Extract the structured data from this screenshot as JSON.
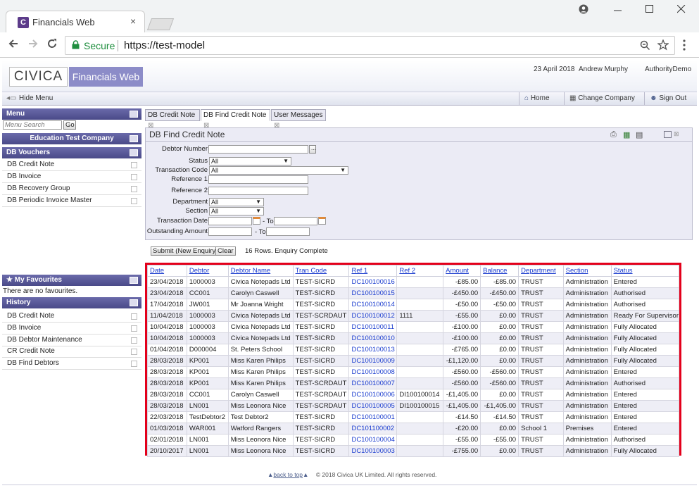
{
  "browser": {
    "tab_title": "Financials Web",
    "tab_icon": "C",
    "tab_close": "×",
    "secure_label": "Secure",
    "url": "https://test-model"
  },
  "header": {
    "logo_left": "CIVICA",
    "logo_right": "Financials Web",
    "date": "23 April 2018",
    "user": "Andrew Murphy",
    "authority": "AuthorityDemo"
  },
  "toolbar": {
    "hide_menu": "Hide Menu",
    "home": "Home",
    "change_company": "Change Company",
    "sign_out": "Sign Out"
  },
  "sidebar": {
    "menu_title": "Menu",
    "search_placeholder": "Menu Search",
    "go_label": "Go",
    "company": "Education Test Company",
    "vouchers_title": "DB Vouchers",
    "vouchers": [
      "DB Credit Note",
      "DB Invoice",
      "DB Recovery Group",
      "DB Periodic Invoice Master"
    ],
    "favourites_title": "My Favourites",
    "favourites_empty": "There are no favourites.",
    "history_title": "History",
    "history": [
      "DB Credit Note",
      "DB Invoice",
      "DB Debtor Maintenance",
      "CR Credit Note",
      "DB Find Debtors"
    ]
  },
  "content_tabs": [
    "DB Credit Note",
    "DB Find Credit Note",
    "User Messages"
  ],
  "panel": {
    "title": "DB Find Credit Note",
    "labels": {
      "debtor_number": "Debtor Number",
      "status": "Status",
      "transaction_code": "Transaction Code",
      "reference1": "Reference 1",
      "reference2": "Reference 2",
      "department": "Department",
      "section": "Section",
      "transaction_date": "Transaction Date",
      "outstanding_amount": "Outstanding Amount",
      "to": "- To"
    },
    "values": {
      "status": "All",
      "transaction_code": "All",
      "department": "All",
      "section": "All"
    },
    "submit": "Submit (New Enquiry)",
    "clear": "Clear",
    "result_text": "16 Rows. Enquiry Complete"
  },
  "table": {
    "headers": [
      "Date",
      "Debtor",
      "Debtor Name",
      "Tran Code",
      "Ref 1",
      "Ref 2",
      "Amount",
      "Balance",
      "Department",
      "Section",
      "Status"
    ],
    "rows": [
      [
        "23/04/2018",
        "1000003",
        "Civica Notepads Ltd",
        "TEST-SICRD",
        "DC100100016",
        "",
        "-£85.00",
        "-£85.00",
        "TRUST",
        "Administration",
        "Entered"
      ],
      [
        "23/04/2018",
        "CC001",
        "Carolyn Caswell",
        "TEST-SICRD",
        "DC100100015",
        "",
        "-£450.00",
        "-£450.00",
        "TRUST",
        "Administration",
        "Authorised"
      ],
      [
        "17/04/2018",
        "JW001",
        "Mr Joanna Wright",
        "TEST-SICRD",
        "DC100100014",
        "",
        "-£50.00",
        "-£50.00",
        "TRUST",
        "Administration",
        "Authorised"
      ],
      [
        "11/04/2018",
        "1000003",
        "Civica Notepads Ltd",
        "TEST-SCRDAUT",
        "DC100100012",
        "1111",
        "-£55.00",
        "£0.00",
        "TRUST",
        "Administration",
        "Ready For Supervisor"
      ],
      [
        "10/04/2018",
        "1000003",
        "Civica Notepads Ltd",
        "TEST-SICRD",
        "DC100100011",
        "",
        "-£100.00",
        "£0.00",
        "TRUST",
        "Administration",
        "Fully Allocated"
      ],
      [
        "10/04/2018",
        "1000003",
        "Civica Notepads Ltd",
        "TEST-SICRD",
        "DC100100010",
        "",
        "-£100.00",
        "£0.00",
        "TRUST",
        "Administration",
        "Fully Allocated"
      ],
      [
        "01/04/2018",
        "D000004",
        "St. Peters School",
        "TEST-SICRD",
        "DC100100013",
        "",
        "-£765.00",
        "£0.00",
        "TRUST",
        "Administration",
        "Fully Allocated"
      ],
      [
        "28/03/2018",
        "KP001",
        "Miss Karen Philips",
        "TEST-SICRD",
        "DC100100009",
        "",
        "-£1,120.00",
        "£0.00",
        "TRUST",
        "Administration",
        "Fully Allocated"
      ],
      [
        "28/03/2018",
        "KP001",
        "Miss Karen Philips",
        "TEST-SICRD",
        "DC100100008",
        "",
        "-£560.00",
        "-£560.00",
        "TRUST",
        "Administration",
        "Entered"
      ],
      [
        "28/03/2018",
        "KP001",
        "Miss Karen Philips",
        "TEST-SCRDAUT",
        "DC100100007",
        "",
        "-£560.00",
        "-£560.00",
        "TRUST",
        "Administration",
        "Authorised"
      ],
      [
        "28/03/2018",
        "CC001",
        "Carolyn Caswell",
        "TEST-SCRDAUT",
        "DC100100006",
        "DI100100014",
        "-£1,405.00",
        "£0.00",
        "TRUST",
        "Administration",
        "Entered"
      ],
      [
        "28/03/2018",
        "LN001",
        "Miss Leonora Nice",
        "TEST-SCRDAUT",
        "DC100100005",
        "DI100100015",
        "-£1,405.00",
        "-£1,405.00",
        "TRUST",
        "Administration",
        "Entered"
      ],
      [
        "22/03/2018",
        "TestDebtor2",
        "Test Debtor2",
        "TEST-SICRD",
        "DC100100001",
        "",
        "-£14.50",
        "-£14.50",
        "TRUST",
        "Administration",
        "Entered"
      ],
      [
        "01/03/2018",
        "WAR001",
        "Watford Rangers",
        "TEST-SICRD",
        "DC101100002",
        "",
        "-£20.00",
        "£0.00",
        "School 1",
        "Premises",
        "Entered"
      ],
      [
        "02/01/2018",
        "LN001",
        "Miss Leonora Nice",
        "TEST-SICRD",
        "DC100100004",
        "",
        "-£55.00",
        "-£55.00",
        "TRUST",
        "Administration",
        "Authorised"
      ],
      [
        "20/10/2017",
        "LN001",
        "Miss Leonora Nice",
        "TEST-SICRD",
        "DC100100003",
        "",
        "-£755.00",
        "£0.00",
        "TRUST",
        "Administration",
        "Fully Allocated"
      ]
    ]
  },
  "footer": {
    "back_to_top": "back to top",
    "copyright": "© 2018 Civica UK Limited. All rights reserved."
  }
}
